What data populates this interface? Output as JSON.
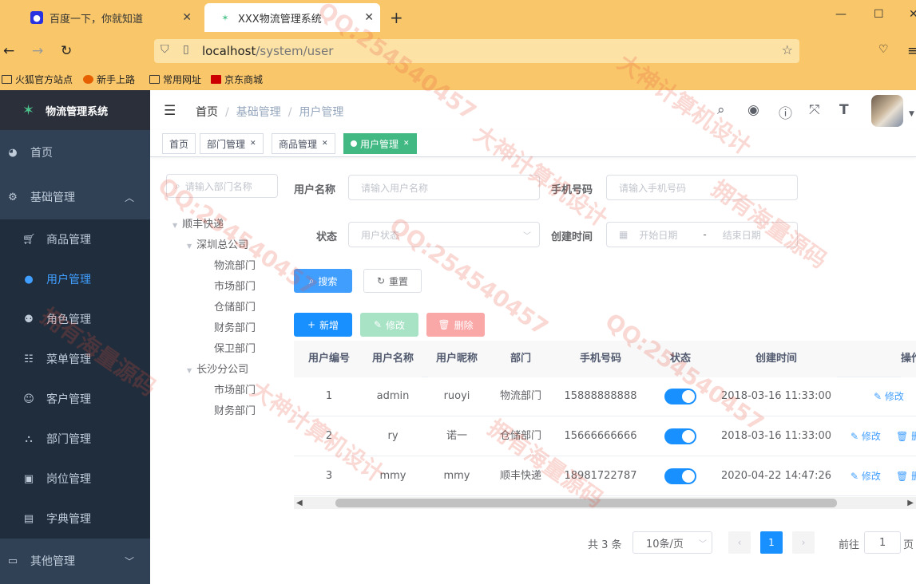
{
  "browser": {
    "tab1_title": "百度一下，你就知道",
    "tab2_title": "XXX物流管理系统",
    "url_host": "localhost",
    "url_path": "/system/user",
    "bookmarks": [
      "火狐官方站点",
      "新手上路",
      "常用网址",
      "京东商城"
    ]
  },
  "sidebar": {
    "logo_title": "物流管理系统",
    "items": [
      {
        "label": "首页",
        "icon": "dashboard-icon"
      },
      {
        "label": "基础管理",
        "icon": "gear-icon"
      },
      {
        "label": "商品管理",
        "icon": "cart-icon"
      },
      {
        "label": "用户管理",
        "icon": "user-icon"
      },
      {
        "label": "角色管理",
        "icon": "peoples-icon"
      },
      {
        "label": "菜单管理",
        "icon": "tree-table-icon"
      },
      {
        "label": "客户管理",
        "icon": "customer-icon"
      },
      {
        "label": "部门管理",
        "icon": "tree-icon"
      },
      {
        "label": "岗位管理",
        "icon": "post-icon"
      },
      {
        "label": "字典管理",
        "icon": "dict-icon"
      },
      {
        "label": "其他管理",
        "icon": "briefcase-icon"
      }
    ]
  },
  "header": {
    "breadcrumb": [
      "首页",
      "基础管理",
      "用户管理"
    ]
  },
  "tags": [
    "首页",
    "部门管理",
    "商品管理",
    "用户管理"
  ],
  "dept_tree": {
    "search_placeholder": "请输入部门名称",
    "nodes": [
      "顺丰快递",
      "深圳总公司",
      "物流部门",
      "市场部门",
      "仓储部门",
      "财务部门",
      "保卫部门",
      "长沙分公司",
      "市场部门",
      "财务部门"
    ]
  },
  "filters": {
    "username_label": "用户名称",
    "username_placeholder": "请输入用户名称",
    "phone_label": "手机号码",
    "phone_placeholder": "请输入手机号码",
    "status_label": "状态",
    "status_placeholder": "用户状态",
    "created_label": "创建时间",
    "start_placeholder": "开始日期",
    "range_sep": "-",
    "end_placeholder": "结束日期",
    "search_button": "搜索",
    "reset_button": "重置"
  },
  "toolbar": {
    "add_button": "新增",
    "edit_button": "修改",
    "delete_button": "删除"
  },
  "table": {
    "headers": [
      "用户编号",
      "用户名称",
      "用户昵称",
      "部门",
      "手机号码",
      "状态",
      "创建时间",
      "操作"
    ],
    "rows": [
      {
        "id": "1",
        "username": "admin",
        "nickname": "ruoyi",
        "dept": "物流部门",
        "phone": "15888888888",
        "status": true,
        "created": "2018-03-16 11:33:00",
        "op_edit": "修改",
        "op_delete": ""
      },
      {
        "id": "2",
        "username": "ry",
        "nickname": "诺一",
        "dept": "仓储部门",
        "phone": "15666666666",
        "status": true,
        "created": "2018-03-16 11:33:00",
        "op_edit": "修改",
        "op_delete": "删"
      },
      {
        "id": "3",
        "username": "mmy",
        "nickname": "mmy",
        "dept": "顺丰快递",
        "phone": "18981722787",
        "status": true,
        "created": "2020-04-22 14:47:26",
        "op_edit": "修改",
        "op_delete": "删"
      }
    ]
  },
  "pagination": {
    "total": "共 3 条",
    "page_size": "10条/页",
    "current_page": "1",
    "goto_label": "前往",
    "goto_value": "1",
    "page_suffix": "页"
  },
  "watermark": {
    "text1": "QQ:254540457",
    "text2": "大神计算机设计",
    "text3": "拥有海量源码"
  },
  "colors": {
    "sidebar_bg": "#304156",
    "accent": "#409eff",
    "tag_active": "#42b983",
    "browser_chrome": "#f9c76a"
  }
}
